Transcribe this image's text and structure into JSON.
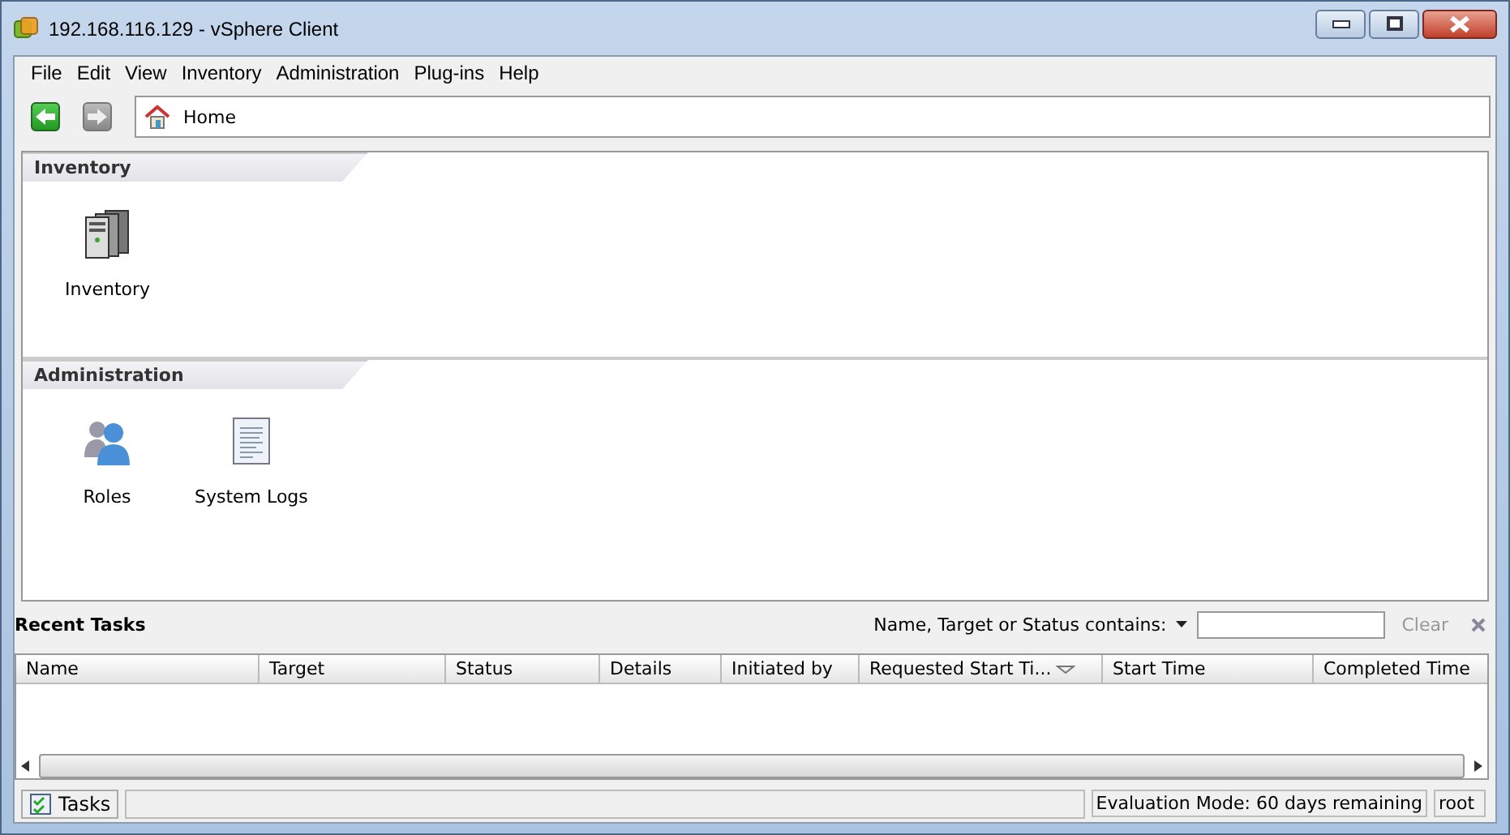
{
  "window": {
    "title": "192.168.116.129 - vSphere Client"
  },
  "menu": [
    "File",
    "Edit",
    "View",
    "Inventory",
    "Administration",
    "Plug-ins",
    "Help"
  ],
  "address": {
    "value": "Home"
  },
  "sections": [
    {
      "title": "Inventory",
      "items": [
        {
          "label": "Inventory",
          "kind": "servers"
        }
      ]
    },
    {
      "title": "Administration",
      "items": [
        {
          "label": "Roles",
          "kind": "users"
        },
        {
          "label": "System Logs",
          "kind": "log"
        }
      ]
    }
  ],
  "recent_tasks": {
    "title": "Recent Tasks",
    "filter_label": "Name, Target or Status contains:",
    "clear": "Clear",
    "columns": [
      {
        "label": "Name",
        "sorted": false
      },
      {
        "label": "Target",
        "sorted": false
      },
      {
        "label": "Status",
        "sorted": false
      },
      {
        "label": "Details",
        "sorted": false
      },
      {
        "label": "Initiated by",
        "sorted": false
      },
      {
        "label": "Requested Start Ti...",
        "sorted": true
      },
      {
        "label": "Start Time",
        "sorted": false
      },
      {
        "label": "Completed Time",
        "sorted": false
      }
    ]
  },
  "status_bar": {
    "tasks": "Tasks",
    "mode": "Evaluation Mode: 60 days remaining",
    "user": "root"
  }
}
